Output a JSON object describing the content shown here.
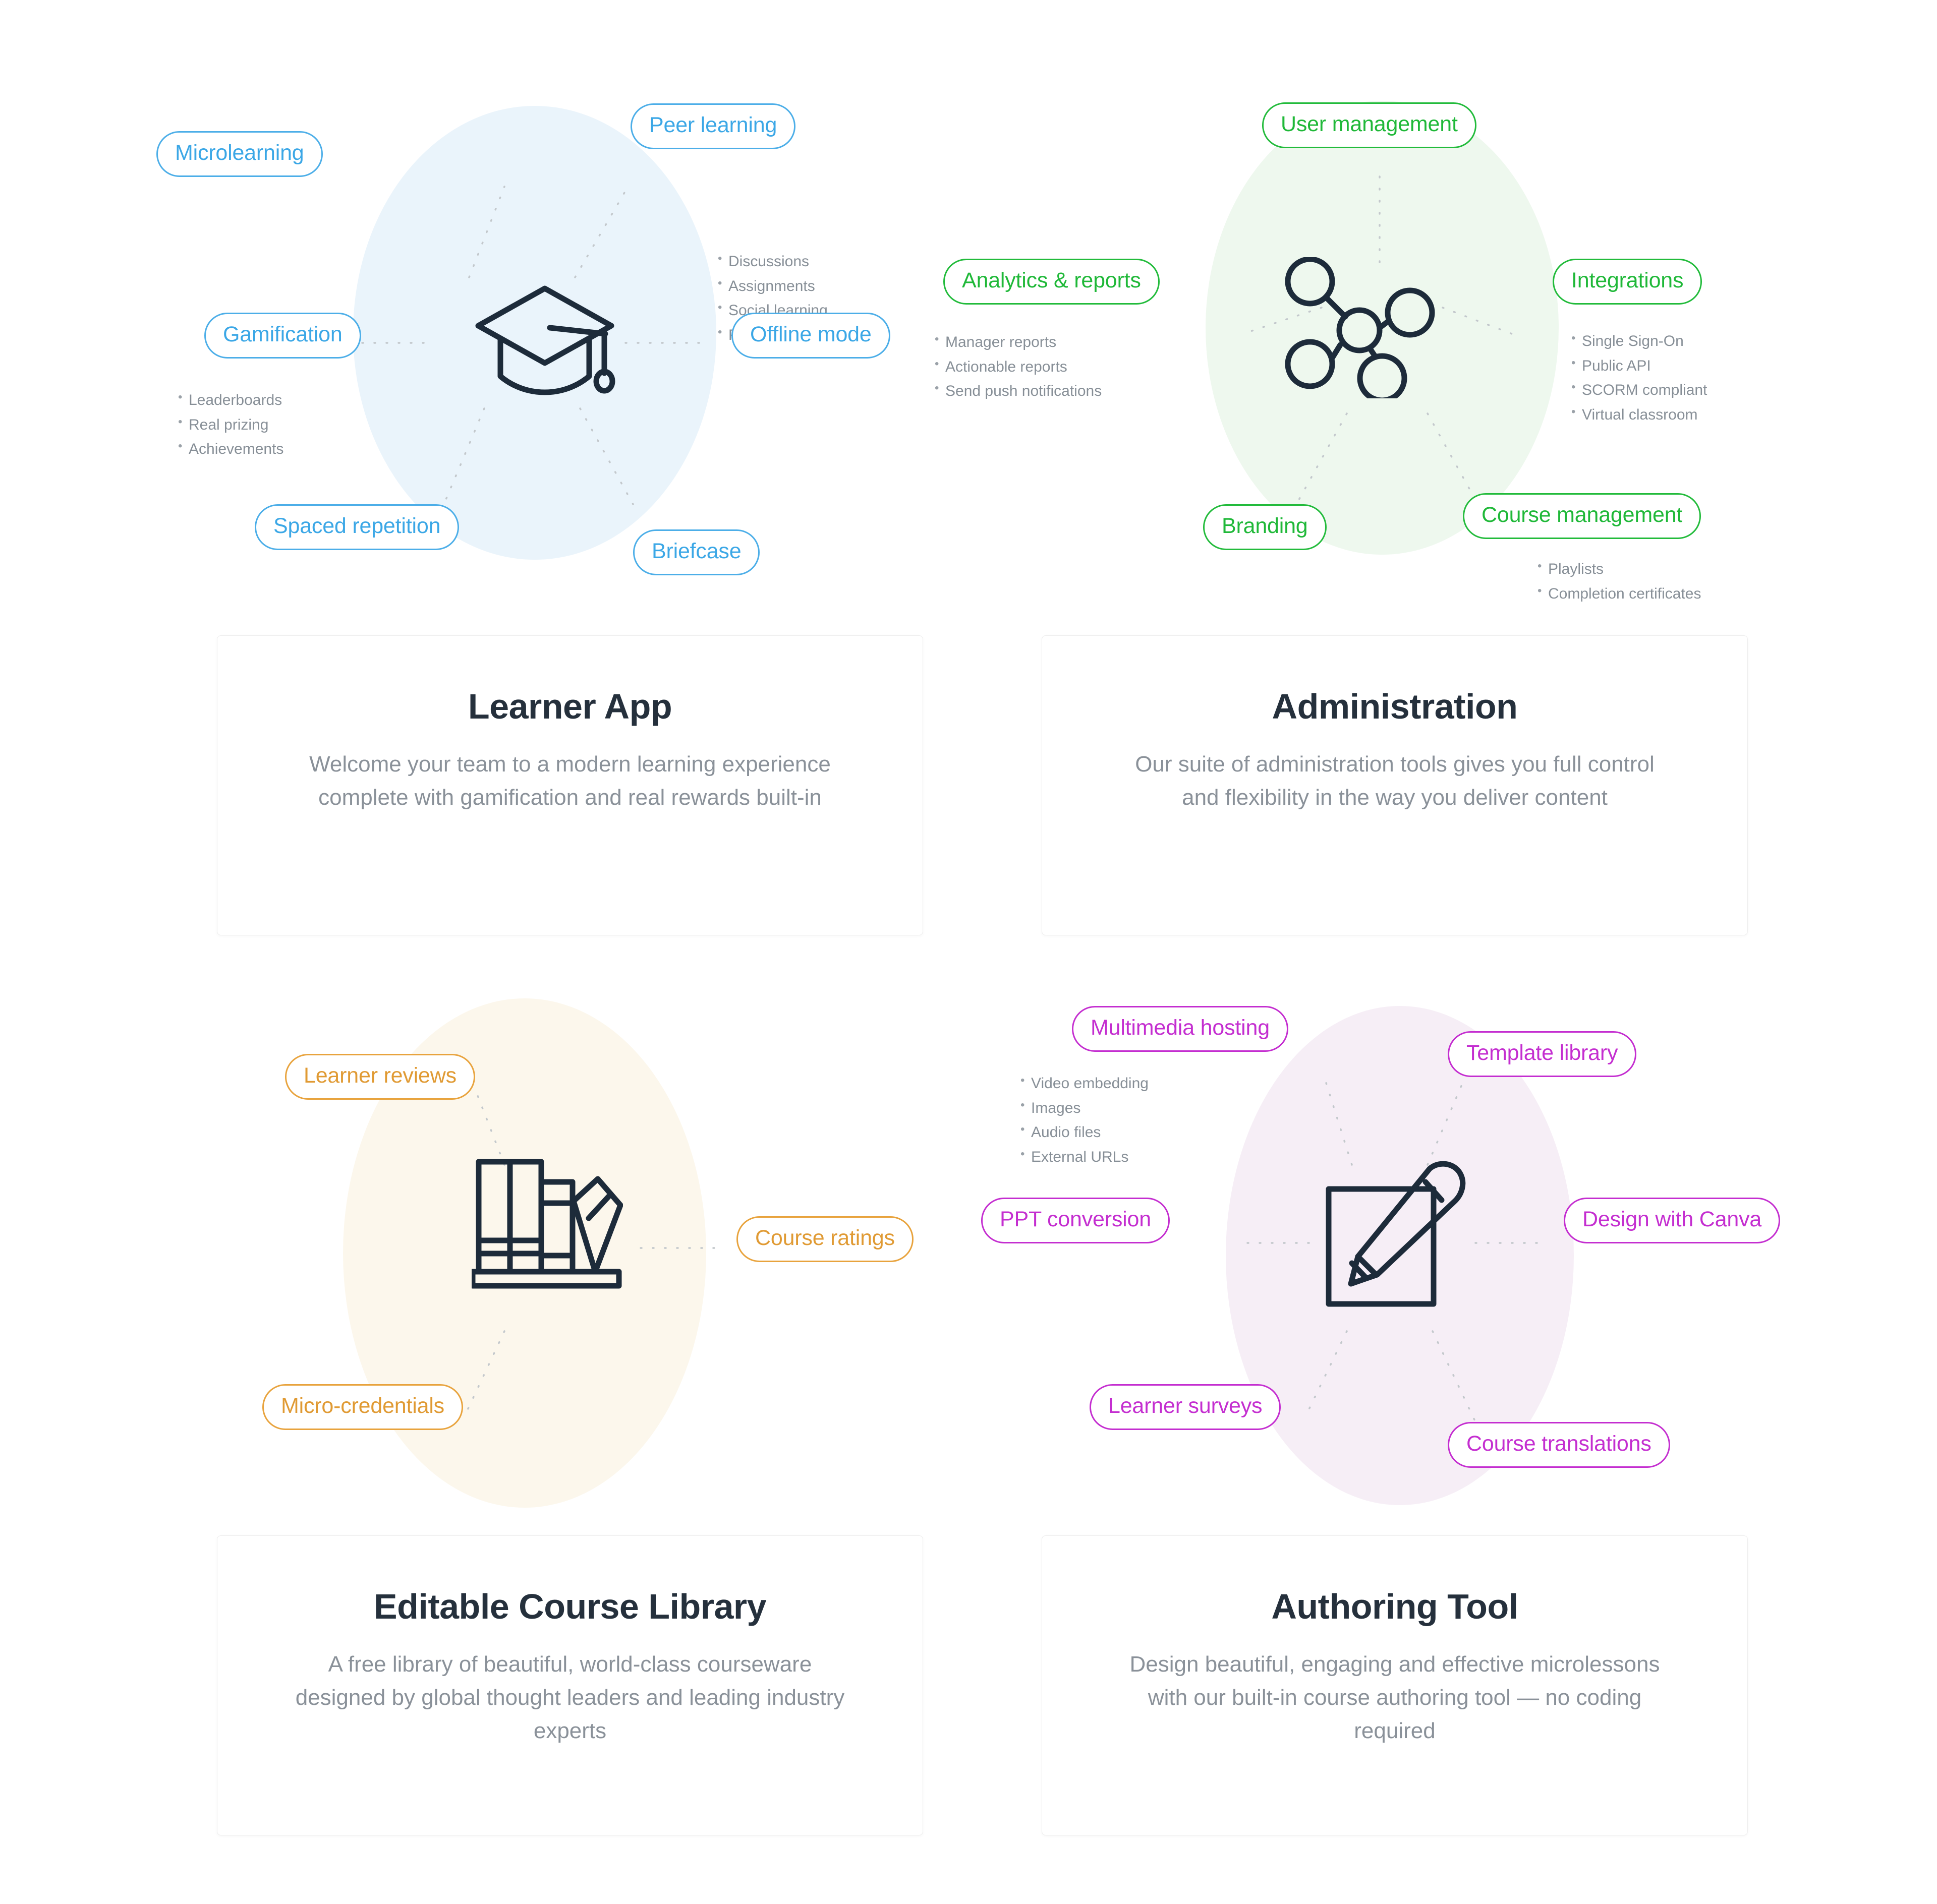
{
  "theme": {
    "blue": "#3ba7e6",
    "green": "#1fb838",
    "orange": "#e09a33",
    "purple": "#c42ed0",
    "ink": "#25303c",
    "muted": "#8a9199"
  },
  "sections": [
    {
      "key": "learner",
      "accent": "#3ba7e6",
      "icon": "graduation-cap-icon",
      "card": {
        "title": "Learner App",
        "description": "Welcome your team to a modern learning experience complete with gamification and real rewards built-in"
      },
      "pills": [
        {
          "label": "Microlearning"
        },
        {
          "label": "Peer learning"
        },
        {
          "label": "Gamification"
        },
        {
          "label": "Offline mode"
        },
        {
          "label": "Spaced repetition"
        },
        {
          "label": "Briefcase"
        }
      ],
      "bullet_groups": [
        {
          "owner": "Peer learning",
          "items": [
            "Discussions",
            "Assignments",
            "Social learning",
            "Peer authoring"
          ]
        },
        {
          "owner": "Gamification",
          "items": [
            "Leaderboards",
            "Real prizing",
            "Achievements"
          ]
        }
      ]
    },
    {
      "key": "admin",
      "accent": "#1fb838",
      "icon": "molecule-network-icon",
      "card": {
        "title": "Administration",
        "description": "Our suite of administration tools gives you full control and flexibility in the way you deliver content"
      },
      "pills": [
        {
          "label": "User management"
        },
        {
          "label": "Analytics & reports"
        },
        {
          "label": "Integrations"
        },
        {
          "label": "Branding"
        },
        {
          "label": "Course management"
        }
      ],
      "bullet_groups": [
        {
          "owner": "Analytics & reports",
          "items": [
            "Manager reports",
            "Actionable reports",
            "Send push notifications"
          ]
        },
        {
          "owner": "Integrations",
          "items": [
            "Single Sign-On",
            "Public API",
            "SCORM compliant",
            "Virtual classroom"
          ]
        },
        {
          "owner": "Course management",
          "items": [
            "Playlists",
            "Completion certificates"
          ]
        }
      ]
    },
    {
      "key": "library",
      "accent": "#e09a33",
      "icon": "books-shelf-icon",
      "card": {
        "title": "Editable Course Library",
        "description": "A free library of beautiful, world-class courseware designed by global thought leaders and leading industry experts"
      },
      "pills": [
        {
          "label": "Learner reviews"
        },
        {
          "label": "Course ratings"
        },
        {
          "label": "Micro-credentials"
        }
      ],
      "bullet_groups": []
    },
    {
      "key": "author",
      "accent": "#c42ed0",
      "icon": "pencil-document-icon",
      "card": {
        "title": "Authoring Tool",
        "description": "Design beautiful, engaging and effective microlessons with our built-in course authoring tool — no coding required"
      },
      "pills": [
        {
          "label": "Multimedia hosting"
        },
        {
          "label": "Template library"
        },
        {
          "label": "PPT conversion"
        },
        {
          "label": "Design with Canva"
        },
        {
          "label": "Learner surveys"
        },
        {
          "label": "Course translations"
        }
      ],
      "bullet_groups": [
        {
          "owner": "Multimedia hosting",
          "items": [
            "Video embedding",
            "Images",
            "Audio files",
            "External URLs"
          ]
        }
      ]
    }
  ]
}
